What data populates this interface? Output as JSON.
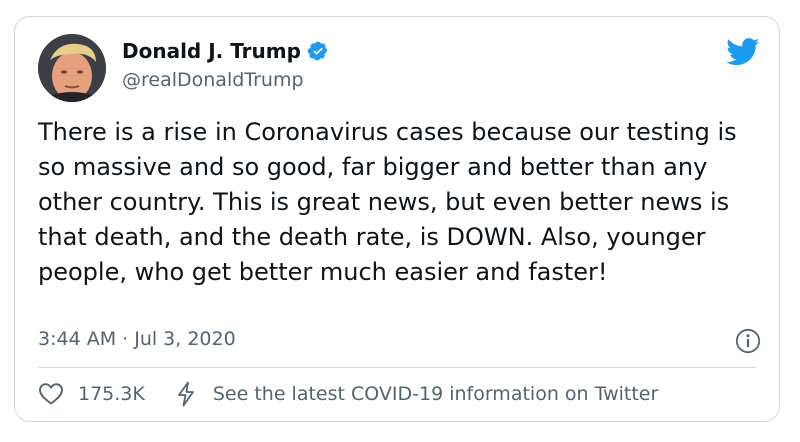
{
  "author": {
    "name": "Donald J. Trump",
    "handle": "@realDonaldTrump",
    "verified": true,
    "avatar_icon": "profile-photo"
  },
  "tweet": {
    "text": "There is a rise in Coronavirus cases because our testing is so massive and so good, far bigger and better than any other country. This is great news, but even better news is that death, and the death rate, is DOWN. Also, younger people, who get better much easier and faster!",
    "timestamp": "3:44 AM · Jul 3, 2020"
  },
  "actions": {
    "like_count": "175.3K",
    "covid_info_label": "See the latest COVID-19 information on Twitter"
  },
  "colors": {
    "twitter_blue": "#1d9bf0",
    "text_primary": "#0f1419",
    "text_secondary": "#536471",
    "border": "#cfd9de"
  },
  "icons": [
    "twitter-bird-icon",
    "verified-badge-icon",
    "info-icon",
    "heart-icon",
    "lightning-bolt-icon"
  ]
}
